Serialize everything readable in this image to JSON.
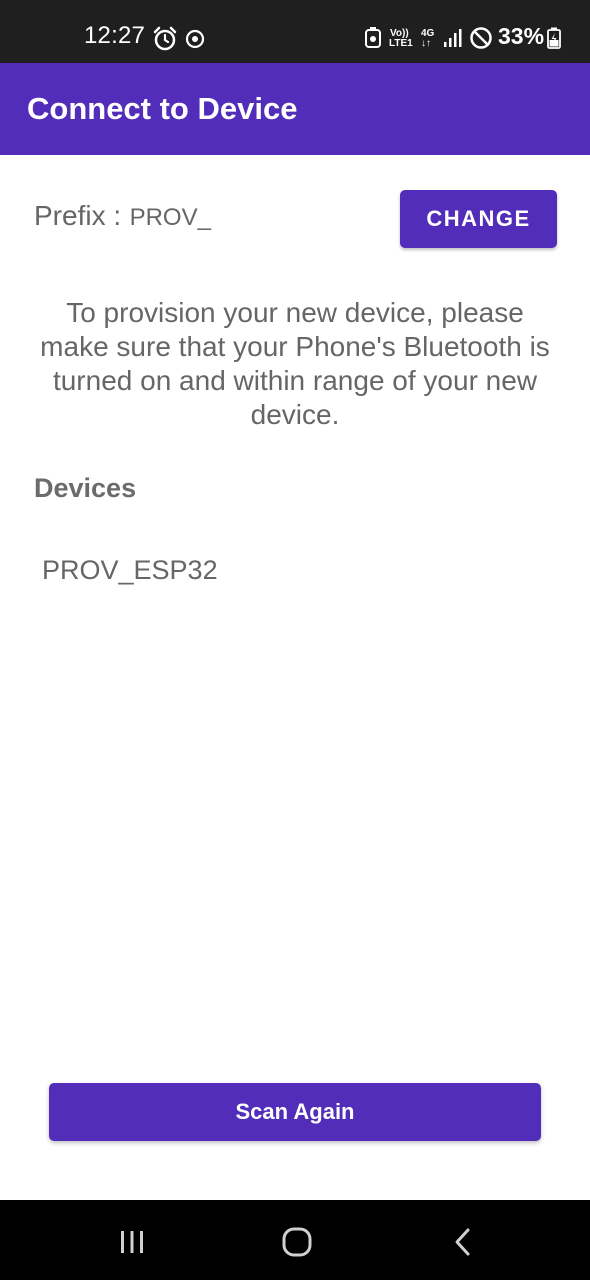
{
  "status_bar": {
    "time": "12:27",
    "battery": "33%",
    "volte_line1": "Vo))",
    "volte_line2": "LTE1",
    "network_type": "4G",
    "icons": [
      "alarm-icon",
      "sync-icon",
      "data-saver-icon",
      "signal-icon",
      "do-not-disturb-icon",
      "battery-charging-icon"
    ]
  },
  "app_bar": {
    "title": "Connect to Device"
  },
  "prefix": {
    "label": "Prefix :",
    "value": "PROV_",
    "change_label": "CHANGE"
  },
  "instructions": "To provision your new device, please make sure that your Phone's Bluetooth is turned on and within range of your new device.",
  "devices": {
    "heading": "Devices",
    "items": [
      {
        "name": "PROV_ESP32"
      }
    ]
  },
  "scan_button_label": "Scan Again",
  "nav_bar": {
    "icons": [
      "recent-apps-icon",
      "home-icon",
      "back-icon"
    ]
  },
  "colors": {
    "primary": "#512DB9",
    "status_bar": "#1f1f1f",
    "text_gray": "#666666"
  }
}
